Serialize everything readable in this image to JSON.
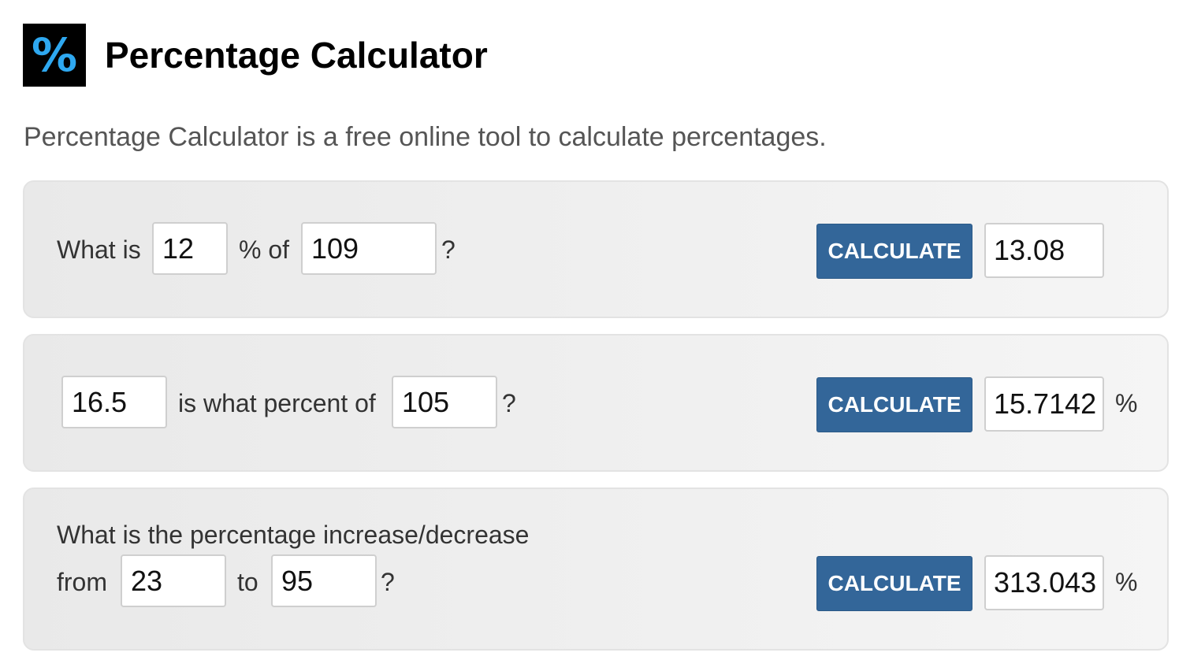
{
  "header": {
    "logo_symbol": "%",
    "title": "Percentage Calculator",
    "subtitle": "Percentage Calculator is a free online tool to calculate percentages."
  },
  "calc1": {
    "prefix": "What is",
    "value_a": "12",
    "middle": "% of",
    "value_b": "109",
    "suffix": "?",
    "button": "CALCULATE",
    "result": "13.08"
  },
  "calc2": {
    "value_a": "16.5",
    "middle": "is what percent of",
    "value_b": "105",
    "suffix": "?",
    "button": "CALCULATE",
    "result": "15.7142",
    "unit": "%"
  },
  "calc3": {
    "line1": "What is the percentage increase/decrease",
    "prefix": "from",
    "value_a": "23",
    "middle": "to",
    "value_b": "95",
    "suffix": "?",
    "button": "CALCULATE",
    "result": "313.043",
    "unit": "%"
  },
  "colors": {
    "button_bg": "#336699",
    "logo_bg": "#000000",
    "logo_symbol": "#2ea8f0"
  }
}
